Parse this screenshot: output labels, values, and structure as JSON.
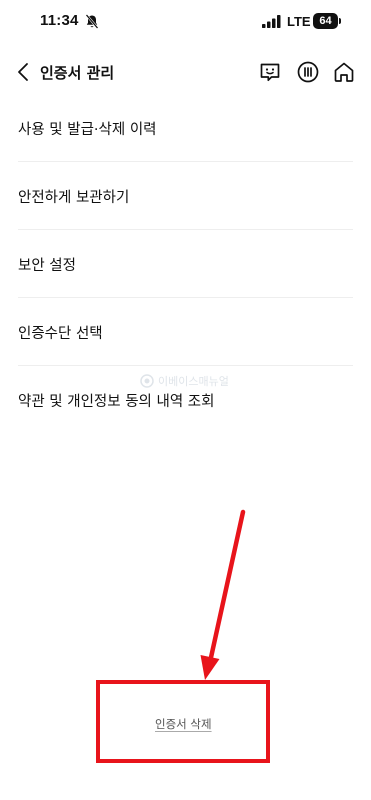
{
  "status_bar": {
    "time": "11:34",
    "network": "LTE",
    "battery": "64"
  },
  "header": {
    "title": "인증서 관리",
    "icons": [
      "chevron-left-icon",
      "chat-face-icon",
      "menu-icon",
      "home-icon"
    ]
  },
  "menu": {
    "items": [
      {
        "label": "사용 및 발급·삭제 이력"
      },
      {
        "label": "안전하게 보관하기"
      },
      {
        "label": "보안 설정"
      },
      {
        "label": "인증수단 선택"
      },
      {
        "label": "약관 및 개인정보 동의 내역 조회"
      }
    ]
  },
  "watermark": {
    "text": "이베이스매뉴얼"
  },
  "footer": {
    "delete_label": "인증서 삭제"
  },
  "colors": {
    "annotation": "#e8141b",
    "text": "#111111",
    "divider": "#eeeeee"
  }
}
